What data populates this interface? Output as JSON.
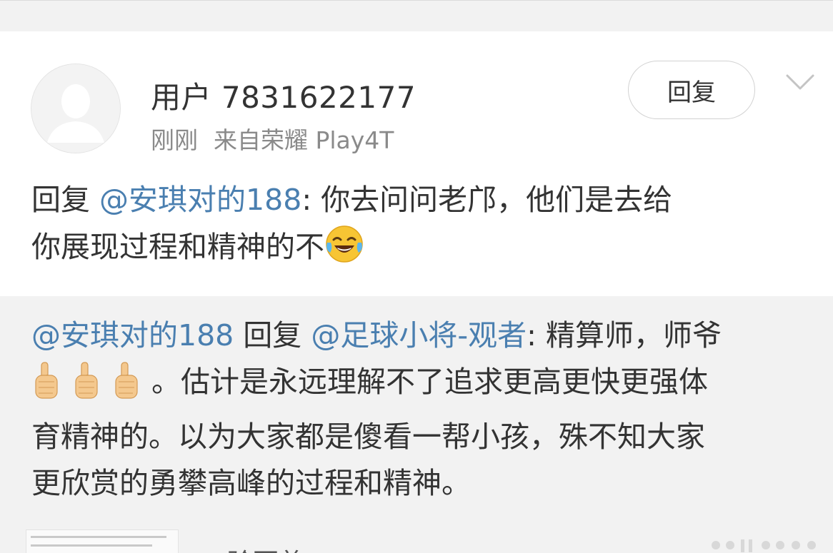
{
  "comment": {
    "username": "用户 7831622177",
    "time": "刚刚",
    "source": "来自荣耀 Play4T",
    "reply_button": "回复",
    "reply_prefix": "回复 ",
    "mention": "@安琪对的188",
    "text_line1": ": 你去问问老邝，他们是去给",
    "text_line2": "你展现过程和精神的不",
    "emoji": "laugh-cry-emoji"
  },
  "quoted": {
    "author_mention": "@安琪对的188",
    "reply_word": " 回复 ",
    "target_mention": "@足球小将-观者",
    "text_line1": ": 精算师，师爷",
    "text_after_thumbs": "。估计是永远理解不了追求更高更快更强体",
    "text_line3": "育精神的。以为大家都是傻看一帮小孩，殊不知大家",
    "text_line4": "更欣赏的勇攀高峰的过程和精神。",
    "thumbs_icon": "thumbs-up-emoji"
  },
  "preview": {
    "caption": "验更着"
  },
  "colors": {
    "link": "#4a7fb0",
    "text": "#333333",
    "meta": "#8a8a8a",
    "quote_bg": "#f2f2f2"
  }
}
